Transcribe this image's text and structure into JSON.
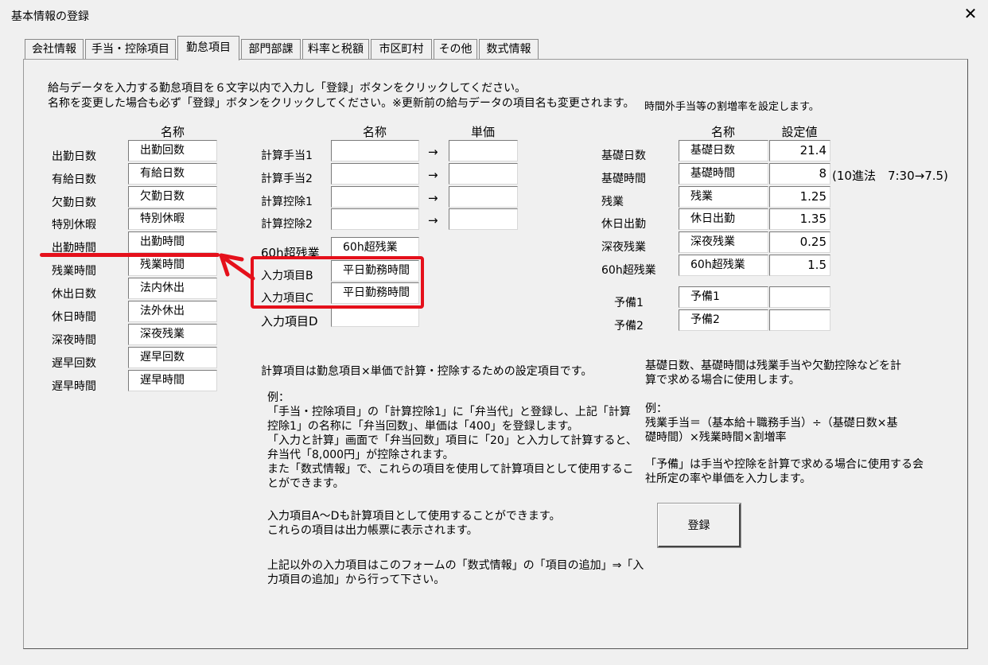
{
  "window": {
    "title": "基本情報の登録",
    "close_glyph": "✕"
  },
  "tabs": [
    {
      "label": "会社情報",
      "active": false
    },
    {
      "label": "手当・控除項目",
      "active": false
    },
    {
      "label": "勤怠項目",
      "active": true
    },
    {
      "label": "部門部課",
      "active": false
    },
    {
      "label": "料率と税額",
      "active": false
    },
    {
      "label": "市区町村",
      "active": false
    },
    {
      "label": "その他",
      "active": false
    },
    {
      "label": "数式情報",
      "active": false
    }
  ],
  "instructions": {
    "line1": "給与データを入力する勤怠項目を６文字以内で入力し「登録」ボタンをクリックしてください。",
    "line2": "名称を変更した場合も必ず「登録」ボタンをクリックしてください。※更新前の給与データの項目名も変更されます。",
    "right_note": "時間外手当等の割増率を設定します。"
  },
  "attendance": {
    "header": "名称",
    "rows": [
      {
        "label": "出勤日数",
        "value": "出勤回数"
      },
      {
        "label": "有給日数",
        "value": "有給日数"
      },
      {
        "label": "欠勤日数",
        "value": "欠勤日数"
      },
      {
        "label": "特別休暇",
        "value": "特別休暇"
      },
      {
        "label": "出勤時間",
        "value": "出勤時間"
      },
      {
        "label": "残業時間",
        "value": "残業時間"
      },
      {
        "label": "休出日数",
        "value": "法内休出"
      },
      {
        "label": "休日時間",
        "value": "法外休出"
      },
      {
        "label": "深夜時間",
        "value": "深夜残業"
      },
      {
        "label": "遅早回数",
        "value": "遅早回数"
      },
      {
        "label": "遅早時間",
        "value": "遅早時間"
      }
    ]
  },
  "calc": {
    "name_header": "名称",
    "price_header": "単価",
    "arrow": "→",
    "rows": [
      {
        "label": "計算手当1",
        "value": "",
        "price": ""
      },
      {
        "label": "計算手当2",
        "value": "",
        "price": ""
      },
      {
        "label": "計算控除1",
        "value": "",
        "price": ""
      },
      {
        "label": "計算控除2",
        "value": "",
        "price": ""
      }
    ]
  },
  "inputs": [
    {
      "label": "60h超残業",
      "value": "60h超残業"
    },
    {
      "label": "入力項目B",
      "value": "平日勤務時間"
    },
    {
      "label": "入力項目C",
      "value": "平日勤務時間"
    },
    {
      "label": "入力項目D",
      "value": ""
    }
  ],
  "rates": {
    "name_header": "名称",
    "value_header": "設定値",
    "rows": [
      {
        "label": "基礎日数",
        "name": "基礎日数",
        "value": "21.4"
      },
      {
        "label": "基礎時間",
        "name": "基礎時間",
        "value": "8"
      },
      {
        "label": "残業",
        "name": "残業",
        "value": "1.25"
      },
      {
        "label": "休日出勤",
        "name": "休日出勤",
        "value": "1.35"
      },
      {
        "label": "深夜残業",
        "name": "深夜残業",
        "value": "0.25"
      },
      {
        "label": "60h超残業",
        "name": "60h超残業",
        "value": "1.5"
      }
    ],
    "decimal_note": "(10進法　7:30→7.5)",
    "spares": [
      {
        "label": "予備1",
        "name": "予備1",
        "value": ""
      },
      {
        "label": "予備2",
        "name": "予備2",
        "value": ""
      }
    ]
  },
  "help_calc": {
    "title": "計算項目は勤怠項目×単価で計算・控除するための設定項目です。",
    "example": "例：\n「手当・控除項目」の「計算控除1」に「弁当代」と登録し、上記「計算\n控除1」の名称に「弁当回数」、単価は「400」を登録します。\n「入力と計算」画面で「弁当回数」項目に「20」と入力して計算すると、\n弁当代「8,000円」が控除されます。\nまた「数式情報」で、これらの項目を使用して計算項目として使用するこ\nとができます。",
    "inputs_note": "入力項目A～Dも計算項目として使用することができます。\nこれらの項目は出力帳票に表示されます。",
    "other_note": "上記以外の入力項目はこのフォームの「数式情報」の「項目の追加」⇒「入\n力項目の追加」から行って下さい。"
  },
  "help_rates": {
    "text1": "基礎日数、基礎時間は残業手当や欠勤控除などを計\n算で求める場合に使用します。",
    "example": "例：\n残業手当＝（基本給＋職務手当）÷（基礎日数×基\n礎時間）×残業時間×割増率",
    "spare_note": "「予備」は手当や控除を計算で求める場合に使用する会\n社所定の率や単価を入力します。"
  },
  "register_button": "登録",
  "colors": {
    "highlight": "#e5101b",
    "background": "#f0f0f0"
  }
}
